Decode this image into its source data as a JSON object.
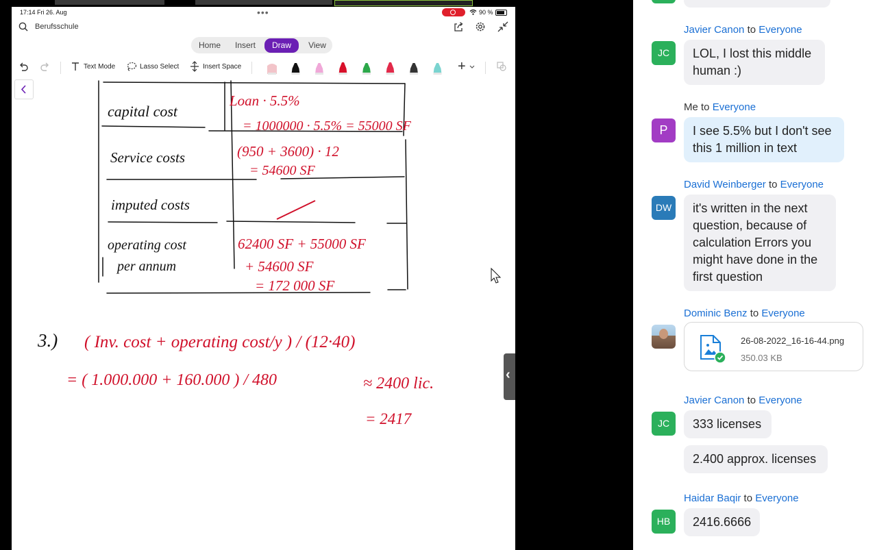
{
  "ipad": {
    "status": {
      "time": "17:14  Fri 26. Aug",
      "battery": "90 %"
    },
    "document_title": "Berufsschule",
    "tabs": [
      "Home",
      "Insert",
      "Draw",
      "View"
    ],
    "active_tab": "Draw",
    "ribbon": {
      "text_mode": "Text Mode",
      "lasso_select": "Lasso Select",
      "insert_space": "Insert Space"
    },
    "pen_colors": [
      "#f2c4c9",
      "#111111",
      "#f0a8d8",
      "#d8102a",
      "#2ca84a",
      "#e22a4a",
      "#333333",
      "#7ad4d0"
    ],
    "handwriting_color": "#d0102a",
    "handwriting": {
      "row1_label": "capital cost",
      "row1_line1": "Loan · 5.5%",
      "row1_line2": "= 1000000 · 5.5% = 55000 SF",
      "row2_label": "Service costs",
      "row2_line1": "(950 + 3600) · 12",
      "row2_line2": "= 54600 SF",
      "row3_label": "imputed costs",
      "row4_label1": "operating cost",
      "row4_label2": "per annum",
      "row4_line1": "62400 SF + 55000 SF",
      "row4_line2": "+ 54600 SF",
      "row4_line3": "= 172 000 SF",
      "q3_num": "3.)",
      "q3_line1": "( Inv. cost + operating cost/y ) / (12·40)",
      "q3_line2": "= ( 1.000.000 + 160.000 ) / 480",
      "q3_approx": "≈ 2400 lic.",
      "q3_line3": "= 2417"
    }
  },
  "chat": {
    "messages": [
      {
        "from": "Javier Canon",
        "to": "Everyone",
        "initials": "JC",
        "avatar_color": "#2bb05b",
        "text": [
          "LOL, I lost this middle",
          "human :)"
        ]
      },
      {
        "from": "Me",
        "to": "Everyone",
        "initials": "P",
        "avatar_color": "#a23cc4",
        "text": [
          "I see 5.5% but I don't see",
          "this 1 million in text"
        ]
      },
      {
        "from": "David Weinberger",
        "to": "Everyone",
        "initials": "DW",
        "avatar_color": "#2a7bb8",
        "text": [
          "it's written in the next",
          "question, because of",
          "calculation Errors you",
          "might have done in the",
          "first question"
        ]
      },
      {
        "from": "Dominic Benz",
        "to": "Everyone",
        "file_name": "26-08-2022_16-16-44.png",
        "file_size": "350.03 KB"
      },
      {
        "from": "Javier Canon",
        "to": "Everyone",
        "initials": "JC",
        "avatar_color": "#2bb05b",
        "text": [
          "333 licenses"
        ],
        "text2": [
          "2.400 approx. licenses"
        ]
      },
      {
        "from": "Haidar Baqir",
        "to": "Everyone",
        "initials": "HB",
        "avatar_color": "#2bb05b",
        "text": [
          "2416.6666"
        ]
      }
    ],
    "to_word": "to"
  }
}
